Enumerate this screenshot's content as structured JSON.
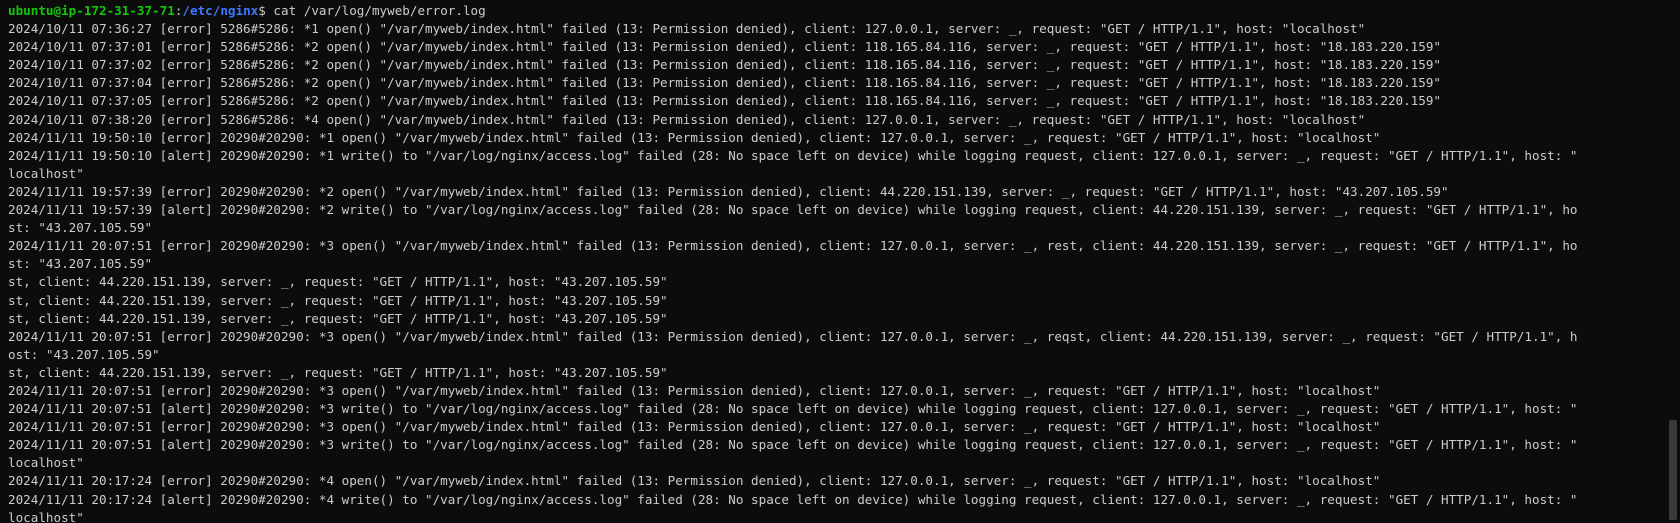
{
  "prompt": {
    "user": "ubuntu@ip-172-31-37-71",
    "colon": ":",
    "cwd": "/etc/nginx",
    "symbol": "$ ",
    "command": "cat /var/log/myweb/error.log"
  },
  "lines": [
    "2024/10/11 07:36:27 [error] 5286#5286: *1 open() \"/var/myweb/index.html\" failed (13: Permission denied), client: 127.0.0.1, server: _, request: \"GET / HTTP/1.1\", host: \"localhost\"",
    "2024/10/11 07:37:01 [error] 5286#5286: *2 open() \"/var/myweb/index.html\" failed (13: Permission denied), client: 118.165.84.116, server: _, request: \"GET / HTTP/1.1\", host: \"18.183.220.159\"",
    "2024/10/11 07:37:02 [error] 5286#5286: *2 open() \"/var/myweb/index.html\" failed (13: Permission denied), client: 118.165.84.116, server: _, request: \"GET / HTTP/1.1\", host: \"18.183.220.159\"",
    "2024/10/11 07:37:04 [error] 5286#5286: *2 open() \"/var/myweb/index.html\" failed (13: Permission denied), client: 118.165.84.116, server: _, request: \"GET / HTTP/1.1\", host: \"18.183.220.159\"",
    "2024/10/11 07:37:05 [error] 5286#5286: *2 open() \"/var/myweb/index.html\" failed (13: Permission denied), client: 118.165.84.116, server: _, request: \"GET / HTTP/1.1\", host: \"18.183.220.159\"",
    "2024/10/11 07:38:20 [error] 5286#5286: *4 open() \"/var/myweb/index.html\" failed (13: Permission denied), client: 127.0.0.1, server: _, request: \"GET / HTTP/1.1\", host: \"localhost\"",
    "2024/11/11 19:50:10 [error] 20290#20290: *1 open() \"/var/myweb/index.html\" failed (13: Permission denied), client: 127.0.0.1, server: _, request: \"GET / HTTP/1.1\", host: \"localhost\"",
    "2024/11/11 19:50:10 [alert] 20290#20290: *1 write() to \"/var/log/nginx/access.log\" failed (28: No space left on device) while logging request, client: 127.0.0.1, server: _, request: \"GET / HTTP/1.1\", host: \"",
    "localhost\"",
    "2024/11/11 19:57:39 [error] 20290#20290: *2 open() \"/var/myweb/index.html\" failed (13: Permission denied), client: 44.220.151.139, server: _, request: \"GET / HTTP/1.1\", host: \"43.207.105.59\"",
    "2024/11/11 19:57:39 [alert] 20290#20290: *2 write() to \"/var/log/nginx/access.log\" failed (28: No space left on device) while logging request, client: 44.220.151.139, server: _, request: \"GET / HTTP/1.1\", ho",
    "st: \"43.207.105.59\"",
    "2024/11/11 20:07:51 [error] 20290#20290: *3 open() \"/var/myweb/index.html\" failed (13: Permission denied), client: 127.0.0.1, server: _, rest, client: 44.220.151.139, server: _, request: \"GET / HTTP/1.1\", ho",
    "st: \"43.207.105.59\"",
    "st, client: 44.220.151.139, server: _, request: \"GET / HTTP/1.1\", host: \"43.207.105.59\"",
    "st, client: 44.220.151.139, server: _, request: \"GET / HTTP/1.1\", host: \"43.207.105.59\"",
    "st, client: 44.220.151.139, server: _, request: \"GET / HTTP/1.1\", host: \"43.207.105.59\"",
    "2024/11/11 20:07:51 [error] 20290#20290: *3 open() \"/var/myweb/index.html\" failed (13: Permission denied), client: 127.0.0.1, server: _, reqst, client: 44.220.151.139, server: _, request: \"GET / HTTP/1.1\", h",
    "ost: \"43.207.105.59\"",
    "st, client: 44.220.151.139, server: _, request: \"GET / HTTP/1.1\", host: \"43.207.105.59\"",
    "2024/11/11 20:07:51 [error] 20290#20290: *3 open() \"/var/myweb/index.html\" failed (13: Permission denied), client: 127.0.0.1, server: _, request: \"GET / HTTP/1.1\", host: \"localhost\"",
    "2024/11/11 20:07:51 [alert] 20290#20290: *3 write() to \"/var/log/nginx/access.log\" failed (28: No space left on device) while logging request, client: 127.0.0.1, server: _, request: \"GET / HTTP/1.1\", host: \"",
    "2024/11/11 20:07:51 [error] 20290#20290: *3 open() \"/var/myweb/index.html\" failed (13: Permission denied), client: 127.0.0.1, server: _, request: \"GET / HTTP/1.1\", host: \"localhost\"",
    "2024/11/11 20:07:51 [alert] 20290#20290: *3 write() to \"/var/log/nginx/access.log\" failed (28: No space left on device) while logging request, client: 127.0.0.1, server: _, request: \"GET / HTTP/1.1\", host: \"",
    "localhost\"",
    "2024/11/11 20:17:24 [error] 20290#20290: *4 open() \"/var/myweb/index.html\" failed (13: Permission denied), client: 127.0.0.1, server: _, request: \"GET / HTTP/1.1\", host: \"localhost\"",
    "2024/11/11 20:17:24 [alert] 20290#20290: *4 write() to \"/var/log/nginx/access.log\" failed (28: No space left on device) while logging request, client: 127.0.0.1, server: _, request: \"GET / HTTP/1.1\", host: \"",
    "localhost\""
  ],
  "colors": {
    "background": "#0c0c0c",
    "text": "#cccccc",
    "user": "#16c60c",
    "cwd": "#3b78ff"
  }
}
